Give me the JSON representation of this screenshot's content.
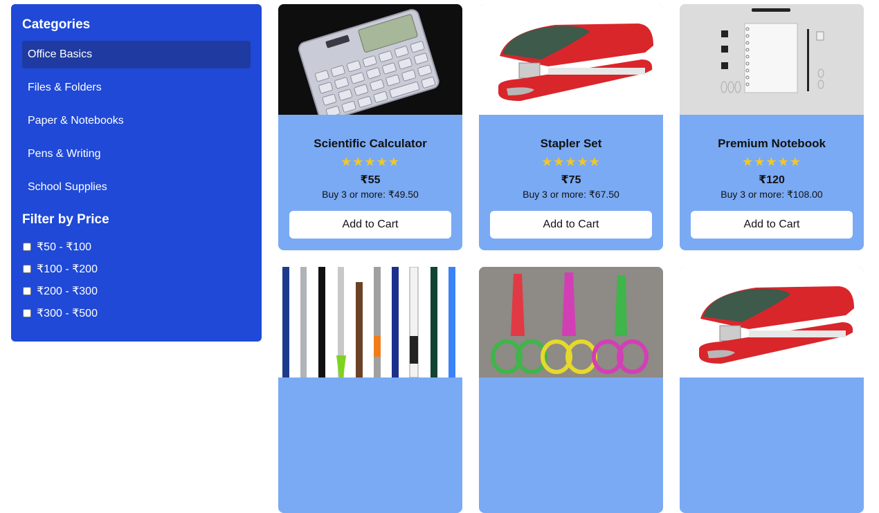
{
  "sidebar": {
    "categories_title": "Categories",
    "categories": [
      {
        "label": "Office Basics",
        "active": true
      },
      {
        "label": "Files & Folders",
        "active": false
      },
      {
        "label": "Paper & Notebooks",
        "active": false
      },
      {
        "label": "Pens & Writing",
        "active": false
      },
      {
        "label": "School Supplies",
        "active": false
      }
    ],
    "price_title": "Filter by Price",
    "price_ranges": [
      "₹50 - ₹100",
      "₹100 - ₹200",
      "₹200 - ₹300",
      "₹300 - ₹500"
    ]
  },
  "products": [
    {
      "name": "Scientific Calculator",
      "rating": "★★★★★",
      "price": "₹55",
      "bulk": "Buy 3 or more: ₹49.50",
      "button": "Add to Cart",
      "image": "calculator"
    },
    {
      "name": "Stapler Set",
      "rating": "★★★★★",
      "price": "₹75",
      "bulk": "Buy 3 or more: ₹67.50",
      "button": "Add to Cart",
      "image": "stapler"
    },
    {
      "name": "Premium Notebook",
      "rating": "★★★★★",
      "price": "₹120",
      "bulk": "Buy 3 or more: ₹108.00",
      "button": "Add to Cart",
      "image": "notebook"
    },
    {
      "image": "pens"
    },
    {
      "image": "scissors"
    },
    {
      "image": "stapler"
    }
  ],
  "colors": {
    "sidebar": "#1f49d6",
    "active_category": "#1f3aa0",
    "card": "#7aaaf4",
    "star": "#f7c81a"
  }
}
